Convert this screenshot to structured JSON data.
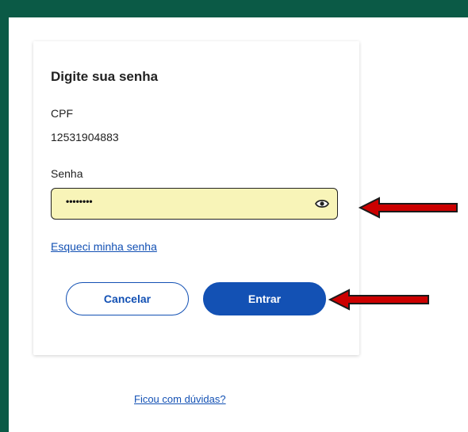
{
  "login": {
    "title": "Digite sua senha",
    "cpf_label": "CPF",
    "cpf_value": "12531904883",
    "password_label": "Senha",
    "password_value": "••••••••",
    "forgot_link": "Esqueci minha senha",
    "cancel_label": "Cancelar",
    "submit_label": "Entrar"
  },
  "help_link": "Ficou com dúvidas?",
  "colors": {
    "background": "#0b5a46",
    "primary": "#1351b4",
    "field_highlight": "#f8f4b8",
    "annotation_arrow": "#cc0000"
  },
  "icons": {
    "password_toggle": "eye-icon",
    "annotations": "red-arrow-icon"
  }
}
